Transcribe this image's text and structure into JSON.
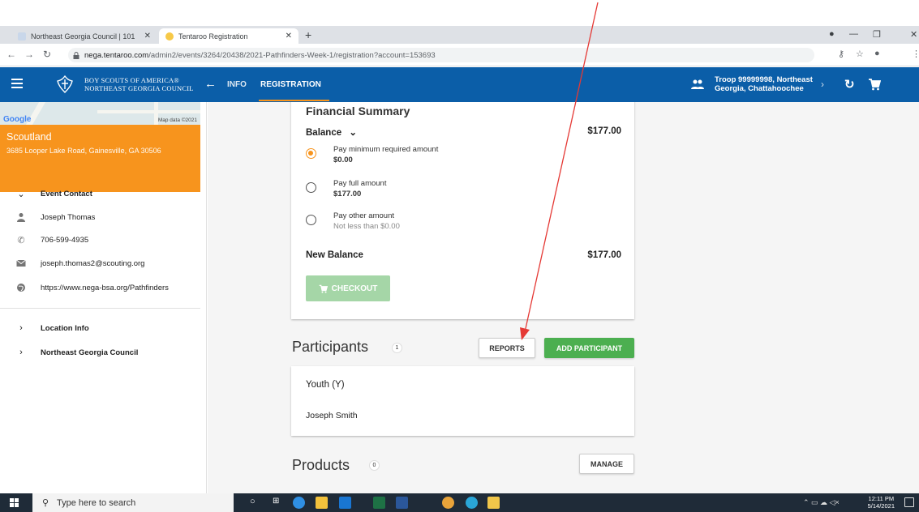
{
  "browser": {
    "tabs": [
      {
        "title": "Northeast Georgia Council | 101",
        "active": false
      },
      {
        "title": "Tentaroo Registration",
        "active": true
      }
    ],
    "new_tab": "+",
    "url_host": "nega.tentaroo.com",
    "url_path": "/admin2/events/3264/20438/2021-Pathfinders-Week-1/registration?account=153693"
  },
  "header": {
    "logo_line1": "BOY SCOUTS OF AMERICA®",
    "logo_line2": "NORTHEAST GEORGIA COUNCIL",
    "nav_info": "INFO",
    "nav_registration": "REGISTRATION",
    "troop_line1": "Troop 99999998, Northeast",
    "troop_line2": "Georgia, Chattahoochee"
  },
  "sidebar": {
    "map_logo": "Google",
    "map_data": "Map data ©2021",
    "venue_name": "Scoutland",
    "venue_address": "3685 Looper Lake Road, Gainesville, GA 30506",
    "event_contact": "Event Contact",
    "contact_name": "Joseph Thomas",
    "contact_phone": "706-599-4935",
    "contact_email": "joseph.thomas2@scouting.org",
    "contact_url": "https://www.nega-bsa.org/Pathfinders",
    "location_info": "Location Info",
    "council": "Northeast Georgia Council"
  },
  "financial": {
    "title": "Financial Summary",
    "balance_label": "Balance",
    "balance_amount": "$177.00",
    "options": [
      {
        "label": "Pay minimum required amount",
        "sub": "$0.00",
        "selected": true
      },
      {
        "label": "Pay full amount",
        "sub": "$177.00",
        "selected": false
      },
      {
        "label": "Pay other amount",
        "sub": "Not less than $0.00",
        "selected": false
      }
    ],
    "new_balance_label": "New Balance",
    "new_balance_amount": "$177.00",
    "checkout_label": "CHECKOUT"
  },
  "participants": {
    "title": "Participants",
    "count": "1",
    "reports_label": "REPORTS",
    "add_label": "ADD PARTICIPANT",
    "group_label": "Youth (Y)",
    "members": [
      "Joseph Smith"
    ]
  },
  "products": {
    "title": "Products",
    "count": "0",
    "manage_label": "MANAGE"
  },
  "taskbar": {
    "search_placeholder": "Type here to search",
    "time": "12:11 PM",
    "date": "5/14/2021"
  },
  "colors": {
    "header_blue": "#0b5ea8",
    "accent_orange": "#f7941d",
    "green": "#4caf50",
    "arrow_red": "#e53935"
  }
}
